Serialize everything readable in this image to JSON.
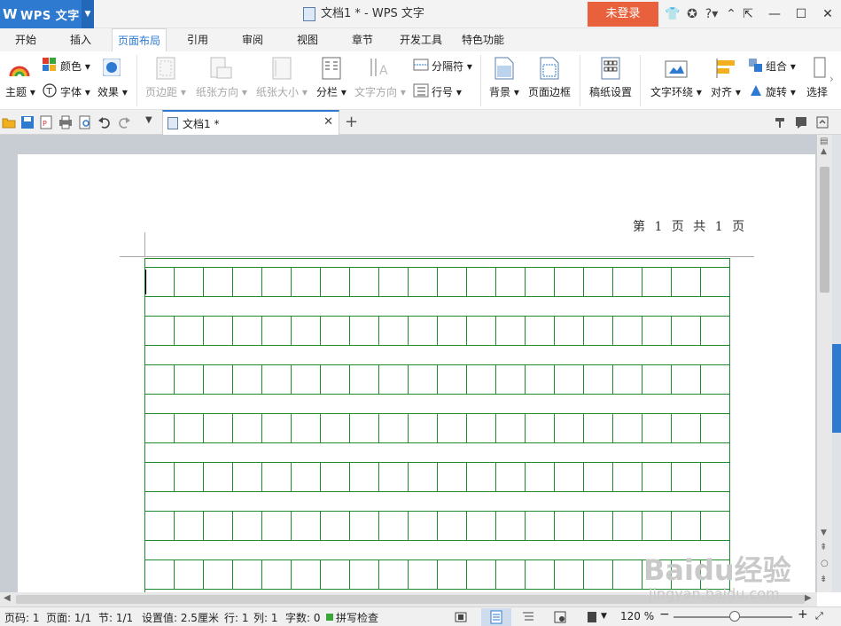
{
  "app": {
    "name": "WPS 文字",
    "logo_letter": "W"
  },
  "window": {
    "title": "文档1 * - WPS 文字",
    "login_label": "未登录"
  },
  "menu_tabs": [
    "开始",
    "插入",
    "页面布局",
    "引用",
    "审阅",
    "视图",
    "章节",
    "开发工具",
    "特色功能"
  ],
  "active_tab": "页面布局",
  "ribbon": {
    "theme": "主题",
    "color": "颜色",
    "font": "字体",
    "effect": "效果",
    "margins": "页边距",
    "orientation": "纸张方向",
    "size": "纸张大小",
    "columns": "分栏",
    "text_direction": "文字方向",
    "separator": "分隔符",
    "line_number": "行号",
    "background": "背景",
    "page_border": "页面边框",
    "manuscript": "稿纸设置",
    "text_wrap": "文字环绕",
    "align": "对齐",
    "group": "组合",
    "rotate": "旋转",
    "select": "选择"
  },
  "document_tab": {
    "label": "文档1 *"
  },
  "page": {
    "header_text": "第 1 页 共 1 页"
  },
  "status": {
    "page_code": "页码: 1",
    "page": "页面: 1/1",
    "section": "节: 1/1",
    "setting": "设置值: 2.5厘米",
    "row": "行: 1",
    "col": "列: 1",
    "words": "字数: 0",
    "spell": "拼写检查",
    "zoom": "120 %"
  },
  "zoom_percent": 120,
  "watermark": {
    "text": "Baidu经验",
    "url": "jingyan.baidu.com"
  },
  "colors": {
    "accent": "#2e7ad1",
    "login": "#e8603c",
    "grid": "#1f8a2b"
  }
}
